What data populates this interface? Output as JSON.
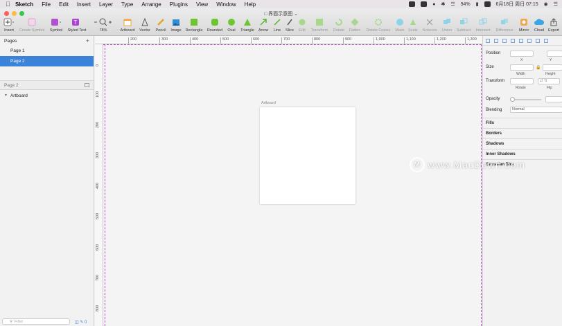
{
  "menubar": {
    "items": [
      "Sketch",
      "File",
      "Edit",
      "Insert",
      "Layer",
      "Type",
      "Arrange",
      "Plugins",
      "View",
      "Window",
      "Help"
    ],
    "battery": "94%",
    "datetime": "6月18日 周日  07:15"
  },
  "window": {
    "title": "界面示意图"
  },
  "toolbar": {
    "tools": [
      {
        "label": "Insert",
        "icon": "plus-icon"
      },
      {
        "label": "Create Symbol",
        "icon": "create-symbol-icon"
      },
      {
        "label": "Symbol",
        "icon": "symbol-icon"
      },
      {
        "label": "Styled Text",
        "icon": "styled-text-icon"
      },
      {
        "label": "78%",
        "icon": "zoom-icon"
      },
      {
        "label": "Artboard",
        "icon": "artboard-icon"
      },
      {
        "label": "Vector",
        "icon": "vector-pen-icon"
      },
      {
        "label": "Pencil",
        "icon": "pencil-icon"
      },
      {
        "label": "Image",
        "icon": "image-icon"
      },
      {
        "label": "Rectangle",
        "icon": "rectangle-icon"
      },
      {
        "label": "Rounded",
        "icon": "rounded-rectangle-icon"
      },
      {
        "label": "Oval",
        "icon": "oval-icon"
      },
      {
        "label": "Triangle",
        "icon": "triangle-icon"
      },
      {
        "label": "Arrow",
        "icon": "arrow-icon"
      },
      {
        "label": "Line",
        "icon": "line-icon"
      },
      {
        "label": "Slice",
        "icon": "slice-icon"
      },
      {
        "label": "Edit",
        "icon": "edit-icon"
      },
      {
        "label": "Transform",
        "icon": "transform-icon"
      },
      {
        "label": "Rotate",
        "icon": "rotate-icon"
      },
      {
        "label": "Flatten",
        "icon": "flatten-icon"
      },
      {
        "label": "Rotate Copies",
        "icon": "rotate-copies-icon"
      },
      {
        "label": "Mask",
        "icon": "mask-icon"
      },
      {
        "label": "Scale",
        "icon": "scale-icon"
      },
      {
        "label": "Scissors",
        "icon": "scissors-icon"
      },
      {
        "label": "Union",
        "icon": "union-icon"
      },
      {
        "label": "Subtract",
        "icon": "subtract-icon"
      },
      {
        "label": "Intersect",
        "icon": "intersect-icon"
      },
      {
        "label": "Difference",
        "icon": "difference-icon"
      },
      {
        "label": "Mirror",
        "icon": "mirror-icon"
      },
      {
        "label": "Cloud",
        "icon": "cloud-icon"
      },
      {
        "label": "Export",
        "icon": "export-icon"
      }
    ]
  },
  "pages_panel": {
    "title": "Pages",
    "pages": [
      "Page 1",
      "Page 2"
    ],
    "selected_page": "Page 2",
    "layers_title": "Page 2",
    "layers": [
      "Artboard"
    ],
    "filter_placeholder": "Filter",
    "bottom_count": "0"
  },
  "ruler": {
    "x_ticks": [
      "200",
      "300",
      "400",
      "500",
      "600",
      "700",
      "800",
      "900",
      "1,000",
      "1,100",
      "1,200",
      "1,300"
    ],
    "y_ticks": [
      "0",
      "100",
      "200",
      "300",
      "400",
      "500",
      "600",
      "700",
      "800"
    ]
  },
  "canvas": {
    "artboard_label": "Artboard"
  },
  "inspector": {
    "position_label": "Position",
    "x_label": "X",
    "y_label": "Y",
    "size_label": "Size",
    "width_label": "Width",
    "height_label": "Height",
    "transform_label": "Transform",
    "rotate_label": "Rotate",
    "flip_label": "Flip",
    "opacity_label": "Opacity",
    "blending_label": "Blending",
    "blending_value": "Normal",
    "sections": [
      "Fills",
      "Borders",
      "Shadows",
      "Inner Shadows",
      "Gaussian Blur"
    ]
  },
  "watermark": {
    "text": "www.MacDown.com"
  },
  "colors": {
    "accent": "#3b83d8",
    "artboard_guide": "#b24bc0"
  }
}
